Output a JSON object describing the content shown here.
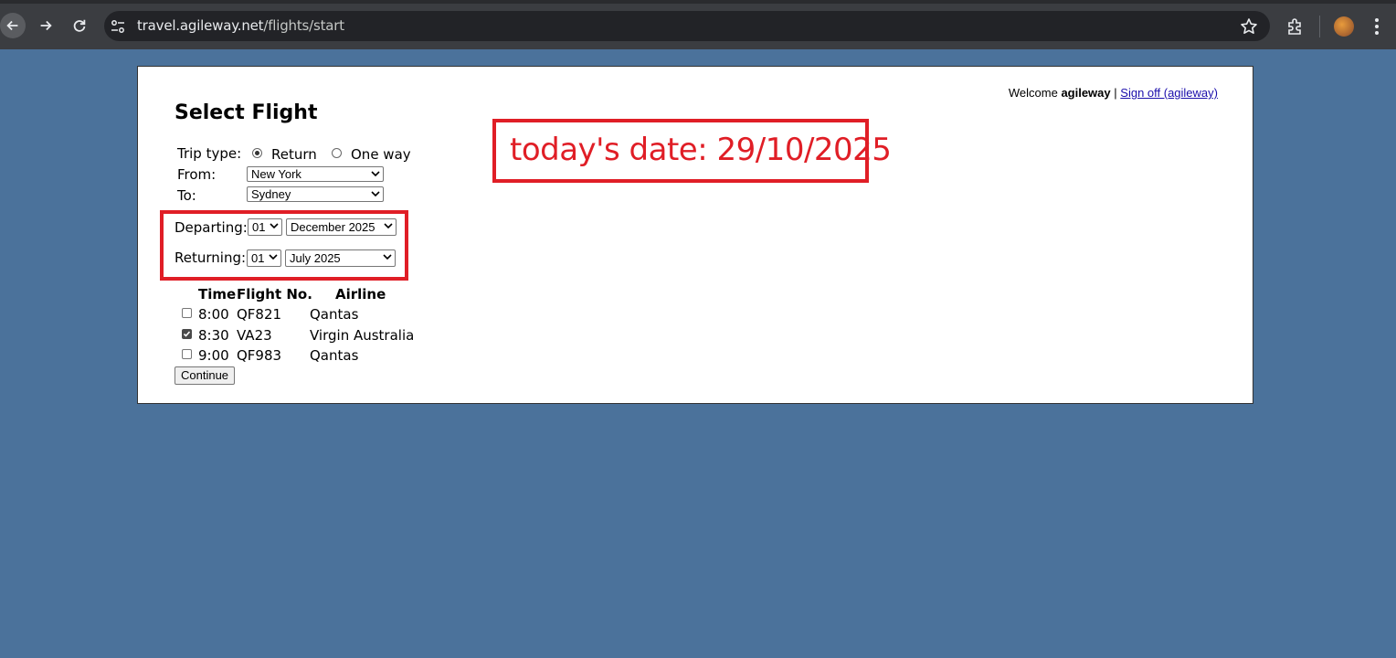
{
  "browser": {
    "url_host": "travel.agileway.net",
    "url_path": "/flights/start"
  },
  "header": {
    "welcome_prefix": "Welcome",
    "username": "agileway",
    "separator": "|",
    "sign_off_label": "Sign off (agileway)"
  },
  "page": {
    "title": "Select Flight"
  },
  "trip": {
    "label": "Trip type:",
    "options": [
      {
        "label": "Return",
        "selected": true
      },
      {
        "label": "One way",
        "selected": false
      }
    ]
  },
  "route": {
    "from_label": "From:",
    "from_value": "New York",
    "to_label": "To:",
    "to_value": "Sydney"
  },
  "dates": {
    "departing_label": "Departing:",
    "departing_day": "01",
    "departing_month": "December 2025",
    "returning_label": "Returning:",
    "returning_day": "01",
    "returning_month": "July 2025"
  },
  "flights": {
    "headers": [
      "Time",
      "Flight No.",
      "Airline"
    ],
    "rows": [
      {
        "checked": false,
        "time": "8:00",
        "flight": "QF821",
        "airline": "Qantas"
      },
      {
        "checked": true,
        "time": "8:30",
        "flight": "VA23",
        "airline": "Virgin Australia"
      },
      {
        "checked": false,
        "time": "9:00",
        "flight": "QF983",
        "airline": "Qantas"
      }
    ]
  },
  "continue_label": "Continue",
  "annotation": {
    "text": "today's date: 29/10/2025",
    "color": "#e01e26"
  },
  "colors": {
    "page_background": "#4b729b",
    "chrome": "#3b3d41"
  }
}
